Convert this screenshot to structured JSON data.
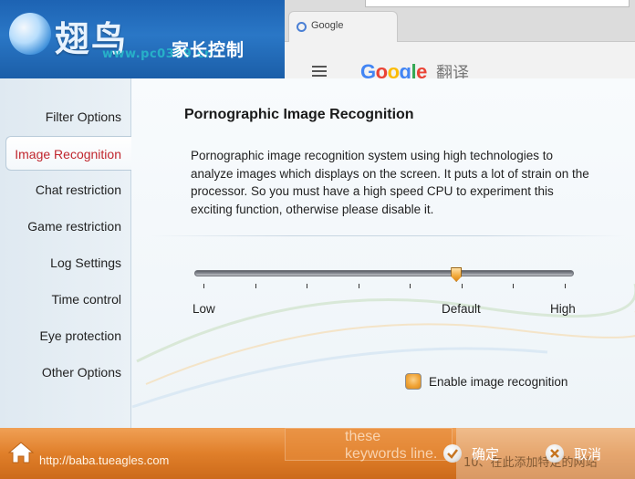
{
  "header": {
    "logo_text": "翅鸟",
    "subtitle": "家长控制",
    "watermark": "www.pc0359.cn"
  },
  "browser_background": {
    "tab_title": "Google",
    "google_wordmark": "Google",
    "translate_label": "翻译"
  },
  "sidebar": {
    "items": [
      {
        "label": "Filter Options",
        "active": false
      },
      {
        "label": "Image Recognition",
        "active": true
      },
      {
        "label": "Chat restriction",
        "active": false
      },
      {
        "label": "Game restriction",
        "active": false
      },
      {
        "label": "Log Settings",
        "active": false
      },
      {
        "label": "Time control",
        "active": false
      },
      {
        "label": "Eye protection",
        "active": false
      },
      {
        "label": "Other Options",
        "active": false
      }
    ]
  },
  "content": {
    "title": "Pornographic Image Recognition",
    "description": "Pornographic image recognition system using high technologies to analyze images which displays on the screen. It puts a lot of strain on the processor. So you must have a high speed CPU to experiment this exciting function, otherwise please disable it.",
    "slider": {
      "labels": {
        "low": "Low",
        "default": "Default",
        "high": "High"
      },
      "value_fraction": 0.7,
      "tick_count": 8
    },
    "checkbox": {
      "label": "Enable image recognition",
      "checked": false
    }
  },
  "footer": {
    "url": "http://baba.tueagles.com",
    "ok_label": "确定",
    "cancel_label": "取消",
    "ghost_text": "these keywords line.",
    "ghost_right_text": "10、在此添加特定的网站"
  },
  "colors": {
    "header_blue": "#1d63b3",
    "footer_orange": "#e07f2a",
    "active_nav_text": "#c0262d",
    "slider_thumb": "#f2a93a"
  }
}
